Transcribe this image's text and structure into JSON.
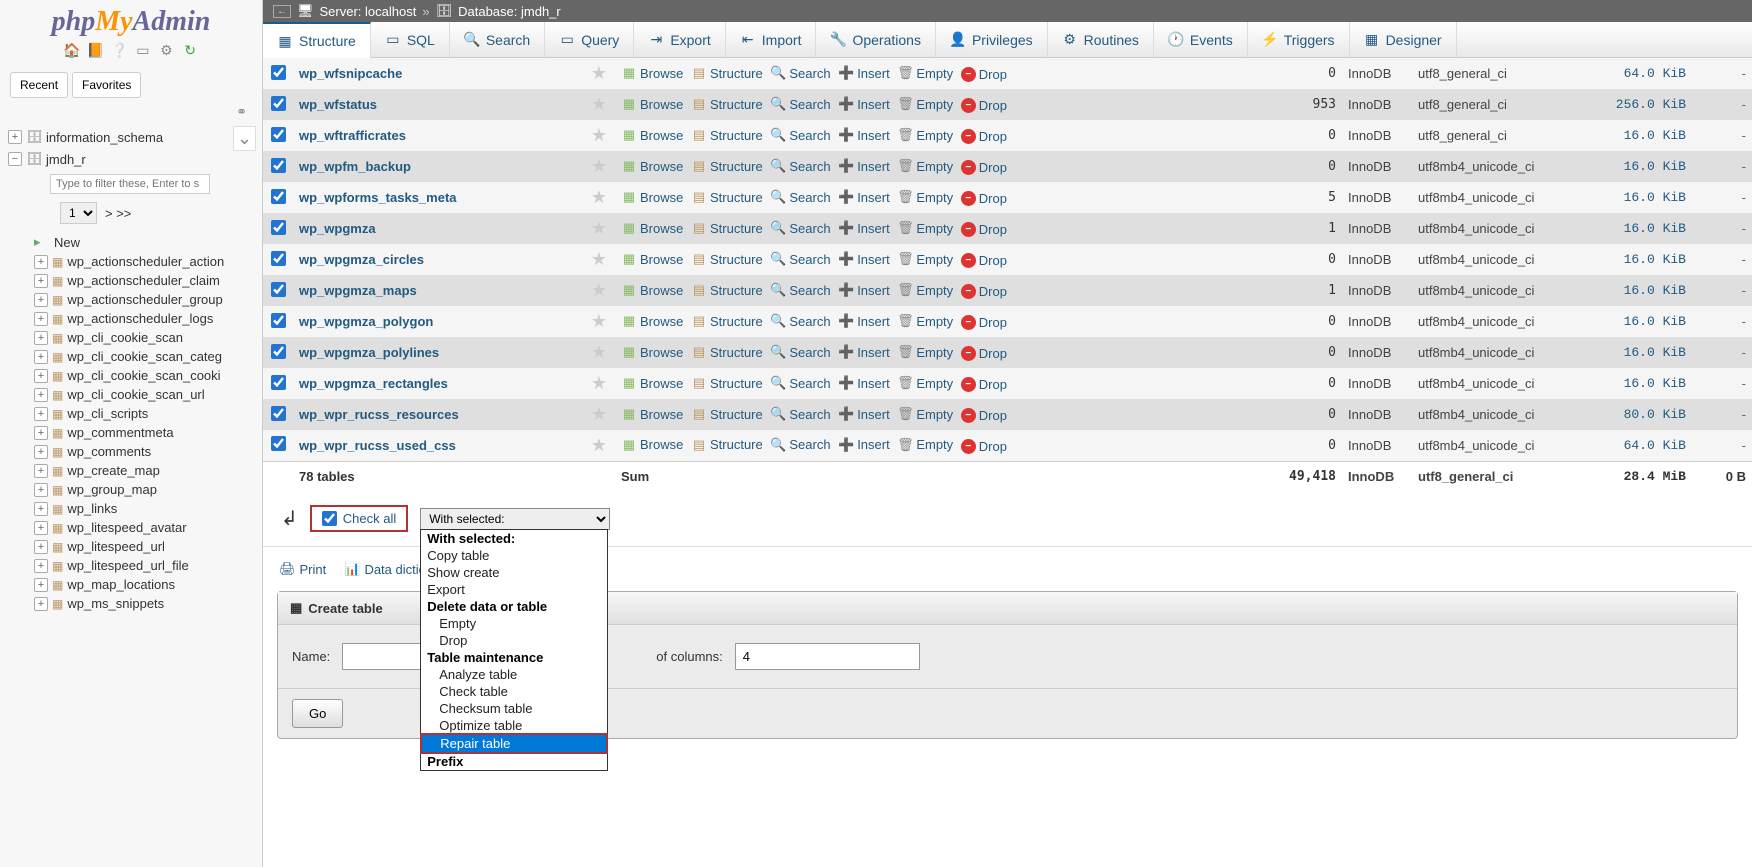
{
  "logo": {
    "php": "php",
    "my": "My",
    "admin": "Admin"
  },
  "sidebar_tabs": {
    "recent": "Recent",
    "favorites": "Favorites"
  },
  "breadcrumb": {
    "server_label": "Server:",
    "server": "localhost",
    "db_label": "Database:",
    "db": "jmdh_r"
  },
  "tabs": [
    {
      "label": "Structure",
      "icon": "▦"
    },
    {
      "label": "SQL",
      "icon": "▭"
    },
    {
      "label": "Search",
      "icon": "🔍"
    },
    {
      "label": "Query",
      "icon": "▭"
    },
    {
      "label": "Export",
      "icon": "⇥"
    },
    {
      "label": "Import",
      "icon": "⇤"
    },
    {
      "label": "Operations",
      "icon": "🔧"
    },
    {
      "label": "Privileges",
      "icon": "👤"
    },
    {
      "label": "Routines",
      "icon": "⚙"
    },
    {
      "label": "Events",
      "icon": "🕐"
    },
    {
      "label": "Triggers",
      "icon": "⚡"
    },
    {
      "label": "Designer",
      "icon": "▦"
    }
  ],
  "tree": {
    "top": "information_schema",
    "db": "jmdh_r",
    "filter_placeholder": "Type to filter these, Enter to s",
    "page": "1",
    "page_more": "> >>",
    "new": "New",
    "tables": [
      "wp_actionscheduler_action",
      "wp_actionscheduler_claim",
      "wp_actionscheduler_group",
      "wp_actionscheduler_logs",
      "wp_cli_cookie_scan",
      "wp_cli_cookie_scan_categ",
      "wp_cli_cookie_scan_cooki",
      "wp_cli_cookie_scan_url",
      "wp_cli_scripts",
      "wp_commentmeta",
      "wp_comments",
      "wp_create_map",
      "wp_group_map",
      "wp_links",
      "wp_litespeed_avatar",
      "wp_litespeed_url",
      "wp_litespeed_url_file",
      "wp_map_locations",
      "wp_ms_snippets"
    ]
  },
  "actions": {
    "browse": "Browse",
    "structure": "Structure",
    "search": "Search",
    "insert": "Insert",
    "empty": "Empty",
    "drop": "Drop"
  },
  "rows": [
    {
      "name": "wp_wfsnipcache",
      "rows": "0",
      "engine": "InnoDB",
      "coll": "utf8_general_ci",
      "size": "64.0 KiB",
      "ov": "-"
    },
    {
      "name": "wp_wfstatus",
      "rows": "953",
      "engine": "InnoDB",
      "coll": "utf8_general_ci",
      "size": "256.0 KiB",
      "ov": "-"
    },
    {
      "name": "wp_wftrafficrates",
      "rows": "0",
      "engine": "InnoDB",
      "coll": "utf8_general_ci",
      "size": "16.0 KiB",
      "ov": "-"
    },
    {
      "name": "wp_wpfm_backup",
      "rows": "0",
      "engine": "InnoDB",
      "coll": "utf8mb4_unicode_ci",
      "size": "16.0 KiB",
      "ov": "-"
    },
    {
      "name": "wp_wpforms_tasks_meta",
      "rows": "5",
      "engine": "InnoDB",
      "coll": "utf8mb4_unicode_ci",
      "size": "16.0 KiB",
      "ov": "-"
    },
    {
      "name": "wp_wpgmza",
      "rows": "1",
      "engine": "InnoDB",
      "coll": "utf8mb4_unicode_ci",
      "size": "16.0 KiB",
      "ov": "-"
    },
    {
      "name": "wp_wpgmza_circles",
      "rows": "0",
      "engine": "InnoDB",
      "coll": "utf8mb4_unicode_ci",
      "size": "16.0 KiB",
      "ov": "-"
    },
    {
      "name": "wp_wpgmza_maps",
      "rows": "1",
      "engine": "InnoDB",
      "coll": "utf8mb4_unicode_ci",
      "size": "16.0 KiB",
      "ov": "-"
    },
    {
      "name": "wp_wpgmza_polygon",
      "rows": "0",
      "engine": "InnoDB",
      "coll": "utf8mb4_unicode_ci",
      "size": "16.0 KiB",
      "ov": "-"
    },
    {
      "name": "wp_wpgmza_polylines",
      "rows": "0",
      "engine": "InnoDB",
      "coll": "utf8mb4_unicode_ci",
      "size": "16.0 KiB",
      "ov": "-"
    },
    {
      "name": "wp_wpgmza_rectangles",
      "rows": "0",
      "engine": "InnoDB",
      "coll": "utf8mb4_unicode_ci",
      "size": "16.0 KiB",
      "ov": "-"
    },
    {
      "name": "wp_wpr_rucss_resources",
      "rows": "0",
      "engine": "InnoDB",
      "coll": "utf8mb4_unicode_ci",
      "size": "80.0 KiB",
      "ov": "-"
    },
    {
      "name": "wp_wpr_rucss_used_css",
      "rows": "0",
      "engine": "InnoDB",
      "coll": "utf8mb4_unicode_ci",
      "size": "64.0 KiB",
      "ov": "-"
    }
  ],
  "sum": {
    "label": "78 tables",
    "sum": "Sum",
    "rows": "49,418",
    "engine": "InnoDB",
    "coll": "utf8_general_ci",
    "size": "28.4 MiB",
    "ov": "0 B"
  },
  "checkall": {
    "label": "Check all",
    "dropdown": "With selected:"
  },
  "dd": [
    {
      "t": "With selected:",
      "h": true
    },
    {
      "t": "Copy table"
    },
    {
      "t": "Show create"
    },
    {
      "t": "Export"
    },
    {
      "t": "Delete data or table",
      "h": true
    },
    {
      "t": "Empty",
      "i": true
    },
    {
      "t": "Drop",
      "i": true
    },
    {
      "t": "Table maintenance",
      "h": true
    },
    {
      "t": "Analyze table",
      "i": true
    },
    {
      "t": "Check table",
      "i": true
    },
    {
      "t": "Checksum table",
      "i": true
    },
    {
      "t": "Optimize table",
      "i": true
    },
    {
      "t": "Repair table",
      "i": true,
      "sel": true
    },
    {
      "t": "Prefix",
      "h": true
    }
  ],
  "footer": {
    "print": "Print",
    "dict": "Data dictionary"
  },
  "create": {
    "title": "Create table",
    "name_label": "Name:",
    "cols_label": "of columns:",
    "cols_val": "4",
    "go": "Go"
  }
}
